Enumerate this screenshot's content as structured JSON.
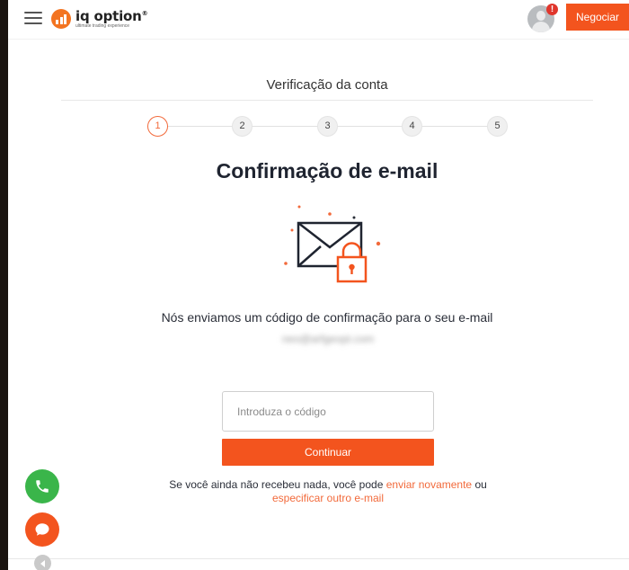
{
  "header": {
    "logo_name": "iq option",
    "logo_registered": "®",
    "logo_tagline": "ultimate trading experience",
    "alert_badge": "!",
    "trade_button": "Negociar"
  },
  "verification": {
    "title": "Verificação da conta",
    "steps": [
      "1",
      "2",
      "3",
      "4",
      "5"
    ],
    "active_step": 1,
    "heading": "Confirmação de e-mail",
    "message": "Nós enviamos um código de confirmação para o seu e-mail",
    "email": "neo@arfgeopt.com",
    "code_placeholder": "Introduza o código",
    "continue_button": "Continuar",
    "note_prefix": "Se você ainda não recebeu nada, você pode",
    "resend_link": "enviar novamente",
    "note_or": "ou",
    "change_email_link": "especificar outro e-mail"
  },
  "floating": {
    "phone_icon": "phone-icon",
    "chat_icon": "chat-icon",
    "collapse_icon": "chevron-left-icon"
  },
  "colors": {
    "accent": "#f3541e",
    "step_active": "#f26a3b",
    "phone_button": "#3ab54a"
  }
}
